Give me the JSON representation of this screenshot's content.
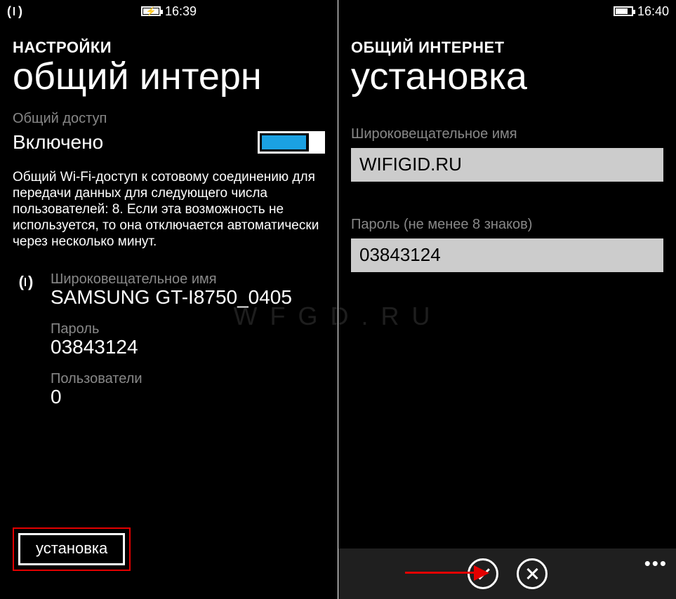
{
  "watermark": "WFGD.RU",
  "left": {
    "status": {
      "time": "16:39"
    },
    "breadcrumb": "НАСТРОЙКИ",
    "title": "общий интерн",
    "sharing_label": "Общий доступ",
    "sharing_value": "Включено",
    "description": "Общий Wi-Fi-доступ к сотовому соединению для передачи данных для следующего числа пользователей: 8. Если эта возможность не используется, то она отключается автоматически через несколько минут.",
    "ssid_label": "Широковещательное имя",
    "ssid_value": "SAMSUNG GT-I8750_0405",
    "password_label": "Пароль",
    "password_value": "03843124",
    "users_label": "Пользователи",
    "users_value": "0",
    "setup_button": "установка"
  },
  "right": {
    "status": {
      "time": "16:40"
    },
    "breadcrumb": "ОБЩИЙ ИНТЕРНЕТ",
    "title": "установка",
    "ssid_label": "Широковещательное имя",
    "ssid_value": "WIFIGID.RU",
    "password_label": "Пароль (не менее 8 знаков)",
    "password_value": "03843124"
  }
}
